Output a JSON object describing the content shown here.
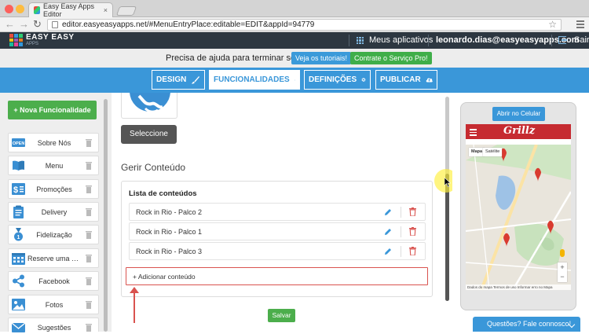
{
  "browser": {
    "tab_title": "Easy Easy Apps Editor",
    "tab_close": "×",
    "url": "editor.easyeasyapps.net/#MenuEntryPlace:editable=EDIT&appId=94779",
    "back": "←",
    "forward": "→",
    "reload": "↻",
    "bookmark": "☆"
  },
  "header": {
    "logo_text": "EASY EASY",
    "logo_sub": "APPS",
    "my_apps": "Meus aplicativos",
    "user_email": "leonardo.dias@easyeasyapps.com",
    "logout": "Sair"
  },
  "helpbar": {
    "text": "Precisa de ajuda para terminar seu app?",
    "tutorials_button": "Veja os tutoriais!",
    "pro_button": "Contrate o Serviço Pro!"
  },
  "tabs": [
    {
      "label": "DESIGN"
    },
    {
      "label": "FUNCIONALIDADES"
    },
    {
      "label": "DEFINIÇÕES"
    },
    {
      "label": "PUBLICAR"
    }
  ],
  "sidebar": {
    "add_button": "+ Nova Funcionalidade",
    "items": [
      {
        "label": "Sobre Nós",
        "icon": "open-sign-icon"
      },
      {
        "label": "Menu",
        "icon": "book-icon"
      },
      {
        "label": "Promoções",
        "icon": "dollar-icon"
      },
      {
        "label": "Delivery",
        "icon": "clipboard-icon"
      },
      {
        "label": "Fidelização",
        "icon": "medal-icon"
      },
      {
        "label": "Reserve uma me...",
        "icon": "calendar-icon"
      },
      {
        "label": "Facebook",
        "icon": "share-icon"
      },
      {
        "label": "Fotos",
        "icon": "photo-icon"
      },
      {
        "label": "Sugestões",
        "icon": "envelope-icon"
      }
    ]
  },
  "main": {
    "select_button": "Seleccione",
    "section_title": "Gerir Conteúdo",
    "list_title": "Lista de conteúdos",
    "rows": [
      {
        "label": "Rock in Rio - Palco 2"
      },
      {
        "label": "Rock in Rio - Palco 1"
      },
      {
        "label": "Rock in Rio - Palco 3"
      }
    ],
    "add_content": "+ Adicionar conteúdo",
    "save_button": "Salvar"
  },
  "preview": {
    "open_phone_button": "Abrir no Celular",
    "app_brand": "Grillz",
    "map_tab_map": "Mapa",
    "map_tab_satellite": "Satélite",
    "map_footer": "Dados do mapa   Termos de uso   Informar erro no Mapa",
    "zoom_in": "+",
    "zoom_out": "−"
  },
  "chat": {
    "label": "Questões? Fale connosco!"
  },
  "colors": {
    "blue": "#3a97d9",
    "green": "#4cae4c",
    "dark_header": "#2d3741",
    "red": "#d9534f",
    "brand_red": "#c62b31"
  }
}
